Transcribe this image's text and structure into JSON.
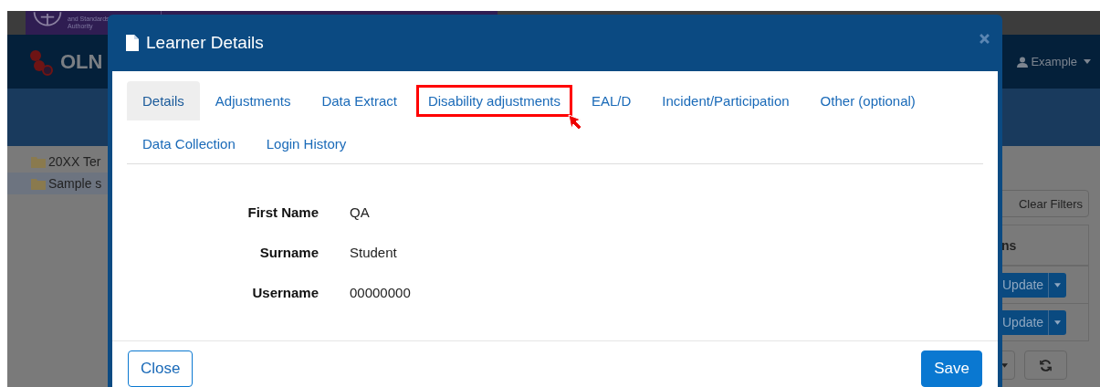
{
  "background_page": {
    "banner": {
      "authority_lines": [
        "and Standards",
        "Authority"
      ]
    },
    "brand": "OLN",
    "user_menu": "Example",
    "tree_items": [
      {
        "label": "20XX Ter",
        "selected": false
      },
      {
        "label": "Sample s",
        "selected": true
      }
    ],
    "clear_filters_button": "Clear Filters",
    "panel_heading": "ns",
    "update_buttons": [
      "Update",
      "Update"
    ]
  },
  "modal": {
    "title": "Learner Details",
    "tabs": [
      {
        "label": "Details",
        "selected": true,
        "highlighted": false
      },
      {
        "label": "Adjustments",
        "selected": false,
        "highlighted": false
      },
      {
        "label": "Data Extract",
        "selected": false,
        "highlighted": false
      },
      {
        "label": "Disability adjustments",
        "selected": false,
        "highlighted": true
      },
      {
        "label": "EAL/D",
        "selected": false,
        "highlighted": false
      },
      {
        "label": "Incident/Participation",
        "selected": false,
        "highlighted": false
      },
      {
        "label": "Other (optional)",
        "selected": false,
        "highlighted": false
      },
      {
        "label": "Data Collection",
        "selected": false,
        "highlighted": false
      },
      {
        "label": "Login History",
        "selected": false,
        "highlighted": false
      }
    ],
    "fields": [
      {
        "label": "First Name",
        "value": "QA"
      },
      {
        "label": "Surname",
        "value": "Student"
      },
      {
        "label": "Username",
        "value": "00000000"
      }
    ],
    "buttons": [
      {
        "label": "Close",
        "kind": "secondary"
      },
      {
        "label": "Save",
        "kind": "primary"
      }
    ]
  }
}
